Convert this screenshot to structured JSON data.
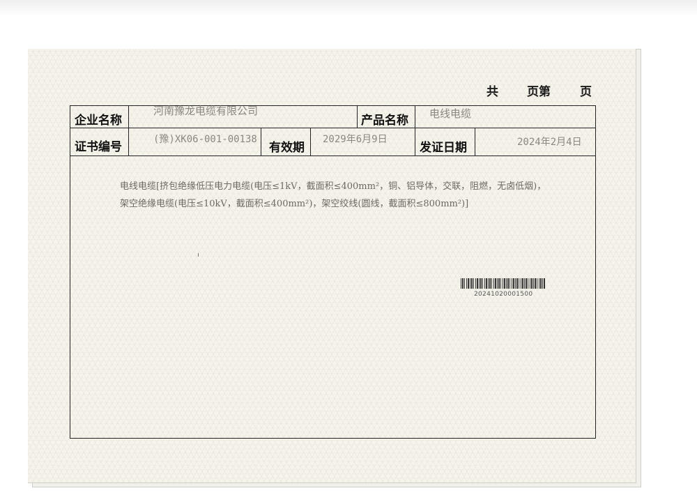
{
  "header": {
    "gong": "共",
    "ye_di": "页第",
    "ye": "页"
  },
  "table": {
    "company_label": "企业名称",
    "company_value": "河南豫龙电缆有限公司",
    "product_label": "产品名称",
    "product_value": "电线电缆",
    "cert_no_label": "证书编号",
    "cert_no_value": "(豫)XK06-001-00138",
    "validity_label": "有效期",
    "validity_value": "2029年6月9日",
    "issue_date_label": "发证日期",
    "issue_date_value": "2024年2月4日"
  },
  "scope": {
    "line1": "电线电缆[挤包绝缘低压电力电缆(电压≤1kV，截面积≤400mm²，铜、铝导体，交联，阻燃，无卤低烟)，",
    "line2": "架空绝缘电缆(电压≤10kV，截面积≤400mm²)，架空绞线(圆线，截面积≤800mm²)]"
  },
  "barcode": {
    "number": "20241020001500"
  }
}
